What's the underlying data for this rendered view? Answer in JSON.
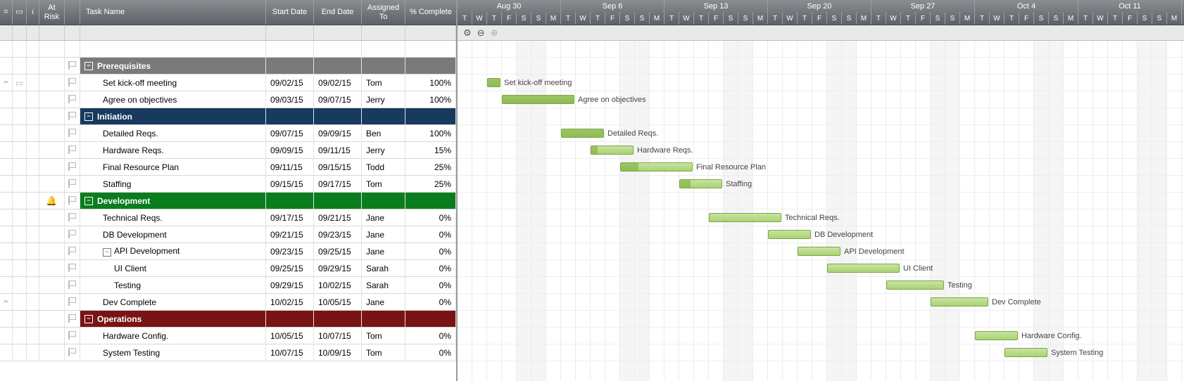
{
  "dayWidth": 21,
  "startOffsetDays": 5,
  "columns": {
    "attach": "",
    "comment": "",
    "info": "i",
    "atRisk": "At Risk",
    "flag": "",
    "taskName": "Task Name",
    "startDate": "Start Date",
    "endDate": "End Date",
    "assignedTo": "Assigned To",
    "pctComplete": "% Complete"
  },
  "weeks": [
    {
      "label": "Aug 30",
      "days": 7
    },
    {
      "label": "Sep 6",
      "days": 7
    },
    {
      "label": "Sep 13",
      "days": 7
    },
    {
      "label": "Sep 20",
      "days": 7
    },
    {
      "label": "Sep 27",
      "days": 7
    },
    {
      "label": "Oct 4",
      "days": 7
    },
    {
      "label": "Oct 11",
      "days": 7
    }
  ],
  "dayPattern": [
    "T",
    "W",
    "T",
    "F",
    "S",
    "S",
    "M"
  ],
  "weekendIdx": [
    4,
    5
  ],
  "toolbar": {
    "gear": "⚙",
    "zoomOut": "⊖",
    "zoomIn": "⊕"
  },
  "rows": [
    {
      "type": "blank"
    },
    {
      "type": "phase",
      "phaseClass": "prereq",
      "name": "Prerequisites"
    },
    {
      "type": "task",
      "indent": 1,
      "name": "Set kick-off meeting",
      "start": "09/02/15",
      "end": "09/02/15",
      "assigned": "Tom",
      "pct": "100%",
      "barStart": 7,
      "barLen": 1,
      "progress": 100,
      "attach": true,
      "comment": true
    },
    {
      "type": "task",
      "indent": 1,
      "name": "Agree on objectives",
      "start": "09/03/15",
      "end": "09/07/15",
      "assigned": "Jerry",
      "pct": "100%",
      "barStart": 8,
      "barLen": 5,
      "progress": 100
    },
    {
      "type": "phase",
      "phaseClass": "init",
      "name": "Initiation"
    },
    {
      "type": "task",
      "indent": 1,
      "name": "Detailed Reqs.",
      "start": "09/07/15",
      "end": "09/09/15",
      "assigned": "Ben",
      "pct": "100%",
      "barStart": 12,
      "barLen": 3,
      "progress": 100
    },
    {
      "type": "task",
      "indent": 1,
      "name": "Hardware Reqs.",
      "start": "09/09/15",
      "end": "09/11/15",
      "assigned": "Jerry",
      "pct": "15%",
      "barStart": 14,
      "barLen": 3,
      "progress": 15
    },
    {
      "type": "task",
      "indent": 1,
      "name": "Final Resource Plan",
      "start": "09/11/15",
      "end": "09/15/15",
      "assigned": "Todd",
      "pct": "25%",
      "barStart": 16,
      "barLen": 5,
      "progress": 25
    },
    {
      "type": "task",
      "indent": 1,
      "name": "Staffing",
      "start": "09/15/15",
      "end": "09/17/15",
      "assigned": "Tom",
      "pct": "25%",
      "barStart": 20,
      "barLen": 3,
      "progress": 25
    },
    {
      "type": "phase",
      "phaseClass": "dev",
      "name": "Development",
      "bell": true
    },
    {
      "type": "task",
      "indent": 1,
      "name": "Technical Reqs.",
      "start": "09/17/15",
      "end": "09/21/15",
      "assigned": "Jane",
      "pct": "0%",
      "barStart": 22,
      "barLen": 5,
      "progress": 0
    },
    {
      "type": "task",
      "indent": 1,
      "name": "DB Development",
      "start": "09/21/15",
      "end": "09/23/15",
      "assigned": "Jane",
      "pct": "0%",
      "barStart": 26,
      "barLen": 3,
      "progress": 0
    },
    {
      "type": "task",
      "indent": 1,
      "name": "API Development",
      "start": "09/23/15",
      "end": "09/25/15",
      "assigned": "Jane",
      "pct": "0%",
      "barStart": 28,
      "barLen": 3,
      "progress": 0,
      "expand": true
    },
    {
      "type": "task",
      "indent": 2,
      "name": "UI Client",
      "start": "09/25/15",
      "end": "09/29/15",
      "assigned": "Sarah",
      "pct": "0%",
      "barStart": 30,
      "barLen": 5,
      "progress": 0
    },
    {
      "type": "task",
      "indent": 2,
      "name": "Testing",
      "start": "09/29/15",
      "end": "10/02/15",
      "assigned": "Sarah",
      "pct": "0%",
      "barStart": 34,
      "barLen": 4,
      "progress": 0
    },
    {
      "type": "task",
      "indent": 1,
      "name": "Dev Complete",
      "start": "10/02/15",
      "end": "10/05/15",
      "assigned": "Jane",
      "pct": "0%",
      "barStart": 37,
      "barLen": 4,
      "progress": 0,
      "attach": true
    },
    {
      "type": "phase",
      "phaseClass": "ops",
      "name": "Operations"
    },
    {
      "type": "task",
      "indent": 1,
      "name": "Hardware Config.",
      "start": "10/05/15",
      "end": "10/07/15",
      "assigned": "Tom",
      "pct": "0%",
      "barStart": 40,
      "barLen": 3,
      "progress": 0
    },
    {
      "type": "task",
      "indent": 1,
      "name": "System Testing",
      "start": "10/07/15",
      "end": "10/09/15",
      "assigned": "Tom",
      "pct": "0%",
      "barStart": 42,
      "barLen": 3,
      "progress": 0
    }
  ]
}
